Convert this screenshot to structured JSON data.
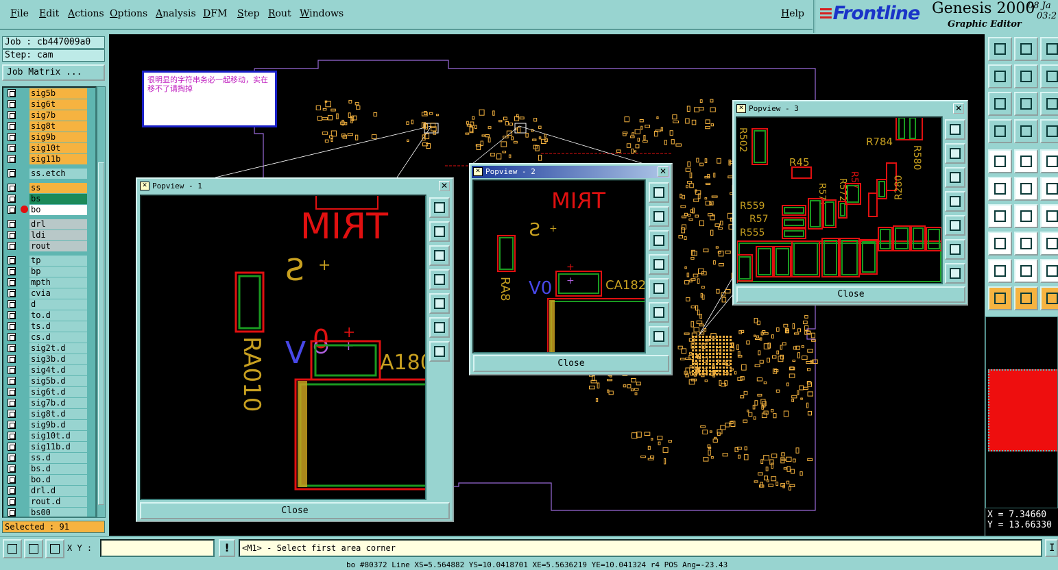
{
  "menu": [
    "File",
    "Edit",
    "Actions",
    "Options",
    "Analysis",
    "DFM",
    "Step",
    "Rout",
    "Windows"
  ],
  "help_label": "Help",
  "brand": {
    "logo": "Frontline",
    "product": "Genesis 2000",
    "subtitle": "Graphic Editor",
    "date": "08 Ja",
    "time": "03:2"
  },
  "job": "Job : cb447009a0",
  "step": "Step: cam",
  "job_matrix": "Job Matrix ...",
  "layers": [
    {
      "name": "sig5b",
      "color": "orange"
    },
    {
      "name": "sig6t",
      "color": "orange"
    },
    {
      "name": "sig7b",
      "color": "orange"
    },
    {
      "name": "sig8t",
      "color": "orange"
    },
    {
      "name": "sig9b",
      "color": "orange"
    },
    {
      "name": "sig10t",
      "color": "orange"
    },
    {
      "name": "sig11b",
      "color": "orange"
    },
    {
      "name": "ss.etch",
      "color": "teal"
    },
    {
      "name": "ss",
      "color": "orange"
    },
    {
      "name": "bs",
      "color": "green"
    },
    {
      "name": "bo",
      "color": "white"
    },
    {
      "name": "drl",
      "color": "gray"
    },
    {
      "name": "ldi",
      "color": "gray"
    },
    {
      "name": "rout",
      "color": "gray"
    },
    {
      "name": "tp",
      "color": "teal"
    },
    {
      "name": "bp",
      "color": "teal"
    },
    {
      "name": "mpth",
      "color": "teal"
    },
    {
      "name": "cvia",
      "color": "teal"
    },
    {
      "name": "d",
      "color": "teal"
    },
    {
      "name": "to.d",
      "color": "teal"
    },
    {
      "name": "ts.d",
      "color": "teal"
    },
    {
      "name": "cs.d",
      "color": "teal"
    },
    {
      "name": "sig2t.d",
      "color": "teal"
    },
    {
      "name": "sig3b.d",
      "color": "teal"
    },
    {
      "name": "sig4t.d",
      "color": "teal"
    },
    {
      "name": "sig5b.d",
      "color": "teal"
    },
    {
      "name": "sig6t.d",
      "color": "teal"
    },
    {
      "name": "sig7b.d",
      "color": "teal"
    },
    {
      "name": "sig8t.d",
      "color": "teal"
    },
    {
      "name": "sig9b.d",
      "color": "teal"
    },
    {
      "name": "sig10t.d",
      "color": "teal"
    },
    {
      "name": "sig11b.d",
      "color": "teal"
    },
    {
      "name": "ss.d",
      "color": "teal"
    },
    {
      "name": "bs.d",
      "color": "teal"
    },
    {
      "name": "bo.d",
      "color": "teal"
    },
    {
      "name": "drl.d",
      "color": "teal"
    },
    {
      "name": "rout.d",
      "color": "teal"
    },
    {
      "name": "bs00",
      "color": "teal"
    }
  ],
  "selected": "Selected : 91",
  "note_text": "很明显的字符串务必一起移动，实在移不了请掏掉",
  "popviews": [
    {
      "title": "Popview - 1",
      "close": "Close"
    },
    {
      "title": "Popview - 2",
      "close": "Close"
    },
    {
      "title": "Popview - 3",
      "close": "Close"
    }
  ],
  "pcb_text": {
    "trim": "TRIM",
    "s_mark": "S",
    "ra010": "RA010",
    "v0": "V0",
    "a180": "A180",
    "ra8": "RA8",
    "ca182": "CA182",
    "r502": "R502",
    "r784": "R784",
    "r45": "R45",
    "r580": "R580",
    "r571": "R571",
    "r572": "R572",
    "r559": "R559",
    "r57": "R57",
    "r555": "R555",
    "r280": "R280"
  },
  "bottom": {
    "xy_label": "X Y :",
    "xy_value": "",
    "excl": "!",
    "prompt": "<M1> - Select first area corner",
    "i_btn": "I"
  },
  "coords": {
    "x": "X = 7.34660",
    "y": "Y = 13.66330"
  },
  "status_line": "bo #80372 Line XS=5.564882 YS=10.0418701 XE=5.5636219 YE=10.041324 r4 POS Ang=-23.43",
  "colors": {
    "accent": "#98d4d0",
    "outline": "#f6b340",
    "pad_red": "#e01010",
    "pad_green": "#1a9a20"
  }
}
